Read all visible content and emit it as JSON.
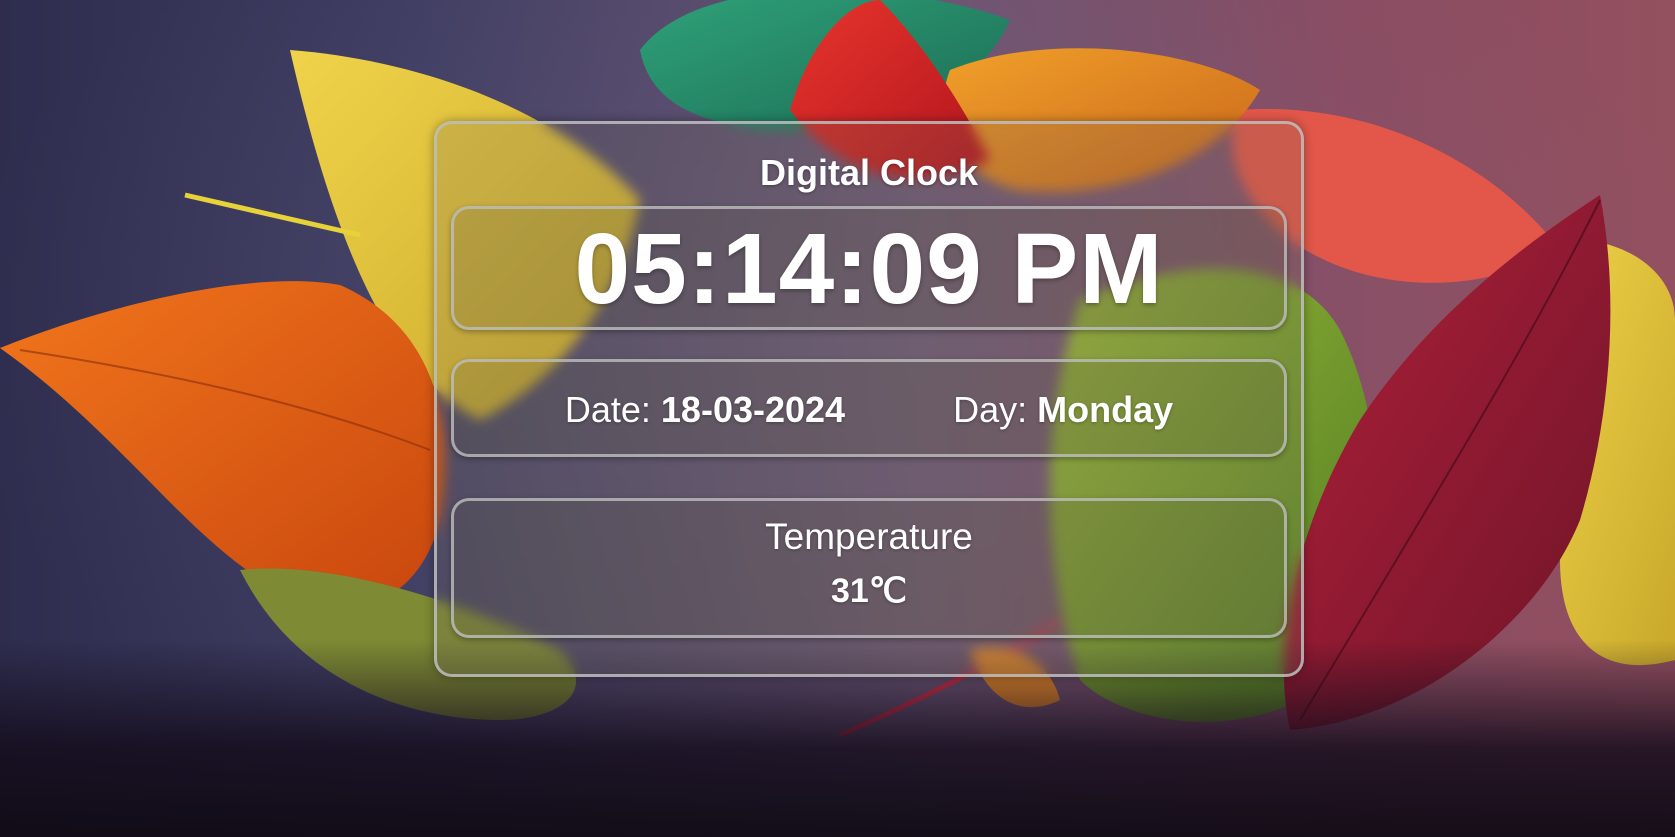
{
  "clock": {
    "title": "Digital Clock",
    "time": "05:14:09 PM",
    "date_label": "Date:",
    "date_value": "18-03-2024",
    "day_label": "Day:",
    "day_value": "Monday",
    "temperature_label": "Temperature",
    "temperature_value": "31℃"
  },
  "background": {
    "description_icon": "autumn-leaves-background"
  },
  "colors": {
    "text": "#ffffff",
    "card_border": "#bebebe"
  }
}
